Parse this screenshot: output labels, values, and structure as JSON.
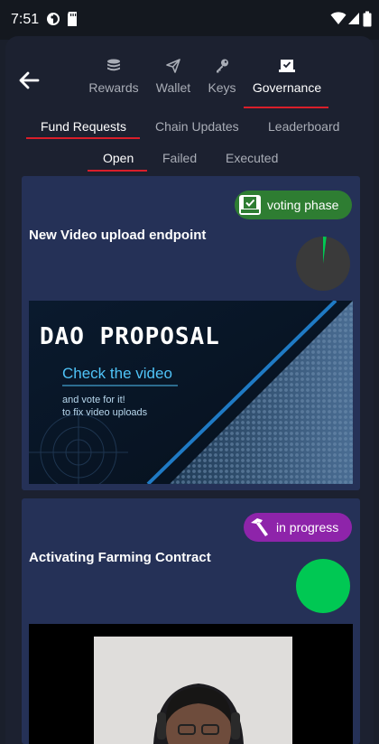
{
  "status_bar": {
    "time": "7:51"
  },
  "nav": {
    "back_icon": "arrow-left-icon",
    "top_tabs": [
      {
        "label": "Rewards",
        "icon": "coins-icon",
        "active": false
      },
      {
        "label": "Wallet",
        "icon": "send-icon",
        "active": false
      },
      {
        "label": "Keys",
        "icon": "key-icon",
        "active": false
      },
      {
        "label": "Governance",
        "icon": "ballot-box-icon",
        "active": true
      }
    ],
    "sub_tabs": [
      {
        "label": "Fund Requests",
        "active": true
      },
      {
        "label": "Chain Updates",
        "active": false
      },
      {
        "label": "Leaderboard",
        "active": false
      }
    ],
    "filter_tabs": [
      {
        "label": "Open",
        "active": true
      },
      {
        "label": "Failed",
        "active": false
      },
      {
        "label": "Executed",
        "active": false
      }
    ]
  },
  "proposals": [
    {
      "title": "New Video upload endpoint",
      "status": "voting phase",
      "status_icon": "ballot-check-icon",
      "status_color": "#2e7d32",
      "vote_progress": 0.02,
      "banner": {
        "heading": "DAO PROPOSAL",
        "subheading": "Check the video",
        "line1": "and vote for it!",
        "line2": "to fix video uploads"
      }
    },
    {
      "title": "Activating Farming Contract",
      "status": "in progress",
      "status_icon": "hammer-icon",
      "status_color": "#8e24aa",
      "vote_progress": 1.0
    }
  ],
  "colors": {
    "accent_underline": "#d91e2a",
    "card_background": "#253157",
    "pie_progress": "#00c853",
    "pie_track": "#3a3a3a"
  }
}
